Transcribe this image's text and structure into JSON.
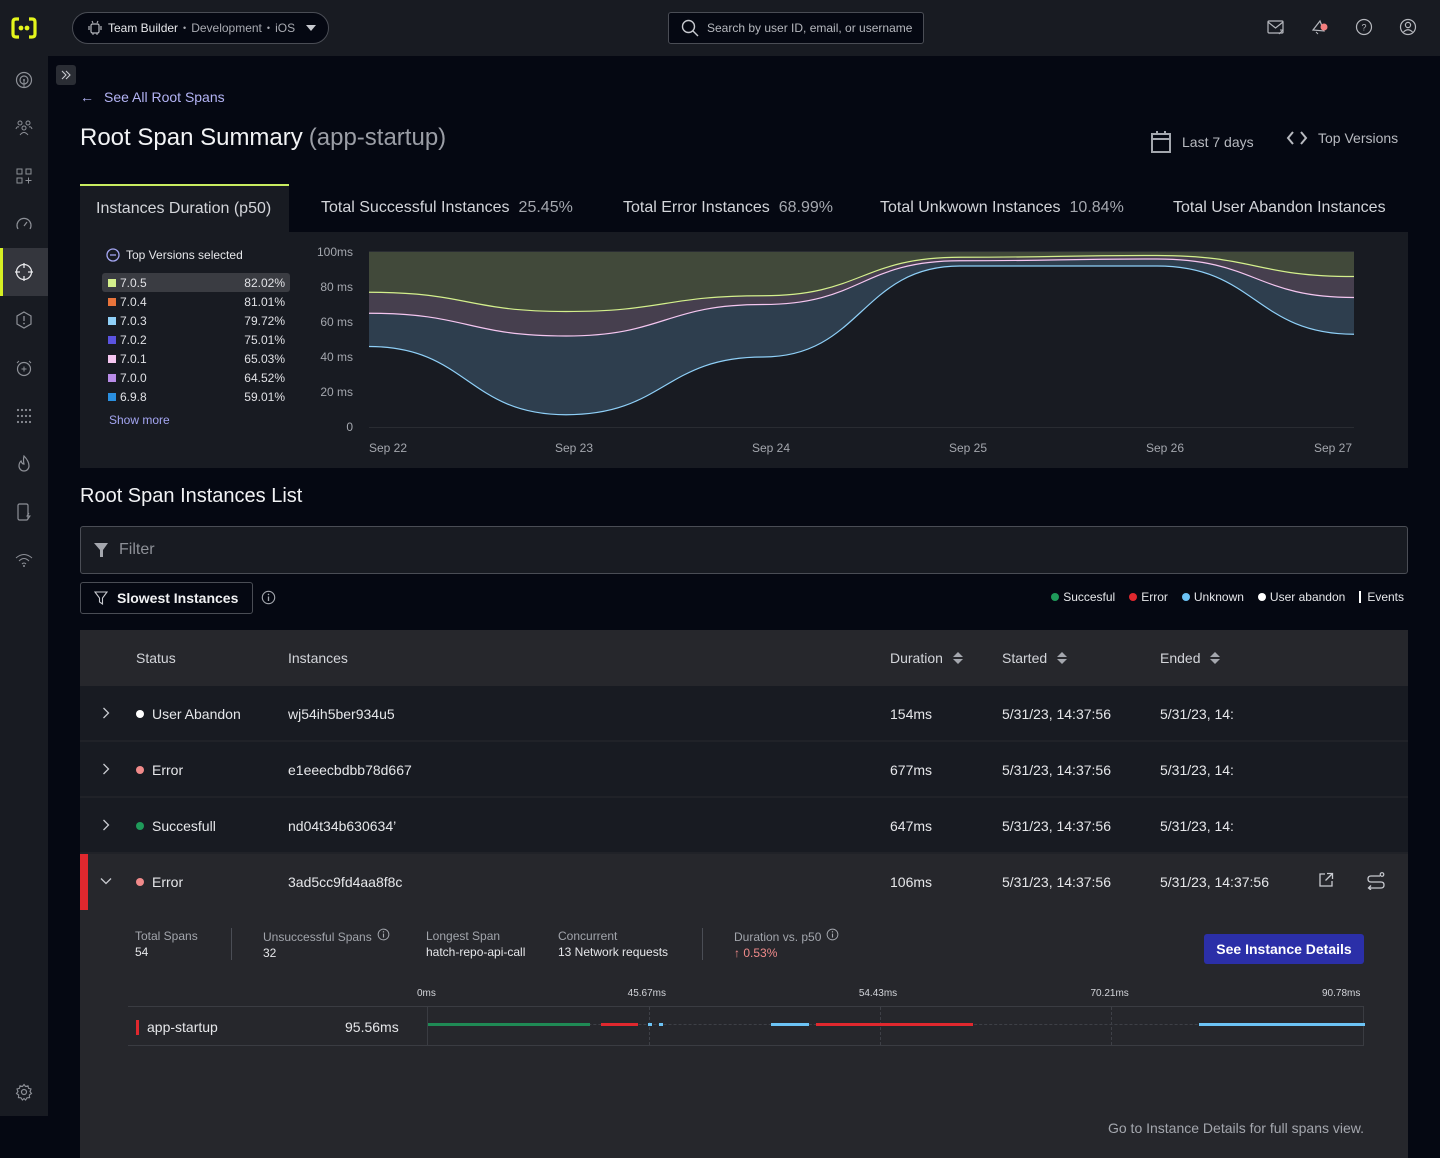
{
  "topbar": {
    "app_name": "Team Builder",
    "environment": "Development",
    "platform": "iOS",
    "search_placeholder": "Search by user ID, email, or username",
    "icons": [
      "mail-share-icon",
      "notification-bell-icon",
      "help-icon",
      "account-icon"
    ]
  },
  "sidebar": {
    "items": [
      {
        "icon": "radar-icon",
        "active": false
      },
      {
        "icon": "users-icon",
        "active": false
      },
      {
        "icon": "dashboard-add-icon",
        "active": false
      },
      {
        "icon": "performance-gauge-icon",
        "active": false
      },
      {
        "icon": "crosshair-target-icon",
        "active": true
      },
      {
        "icon": "alert-hexagon-icon",
        "active": false
      },
      {
        "icon": "alarm-icon",
        "active": false
      },
      {
        "icon": "grid-dots-icon",
        "active": false
      },
      {
        "icon": "flame-icon",
        "active": false
      },
      {
        "icon": "device-power-icon",
        "active": false
      },
      {
        "icon": "wifi-icon",
        "active": false
      }
    ],
    "settings_icon": "gear-icon"
  },
  "header": {
    "back_label": "See All Root Spans",
    "title": "Root Span Summary",
    "subtitle": "(app-startup)",
    "date_range": "Last 7 days",
    "versions_label": "Top Versions"
  },
  "tabs": [
    {
      "label": "Instances Duration (p50)",
      "value": "",
      "active": true
    },
    {
      "label": "Total Successful Instances",
      "value": "25.45%",
      "active": false
    },
    {
      "label": "Total Error Instances",
      "value": "68.99%",
      "active": false
    },
    {
      "label": "Total Unkwown Instances",
      "value": "10.84%",
      "active": false
    },
    {
      "label": "Total User Abandon Instances",
      "value": "",
      "active": false
    }
  ],
  "versions_legend": {
    "title": "Top Versions selected",
    "items": [
      {
        "version": "7.0.5",
        "pct": "82.02%",
        "color": "#d4f08c",
        "selected": true
      },
      {
        "version": "7.0.4",
        "pct": "81.01%",
        "color": "#e8743b",
        "selected": false
      },
      {
        "version": "7.0.3",
        "pct": "79.72%",
        "color": "#8fd0f8",
        "selected": false
      },
      {
        "version": "7.0.2",
        "pct": "75.01%",
        "color": "#5b53e0",
        "selected": false
      },
      {
        "version": "7.0.1",
        "pct": "65.03%",
        "color": "#f5c6f0",
        "selected": false
      },
      {
        "version": "7.0.0",
        "pct": "64.52%",
        "color": "#b98ce8",
        "selected": false
      },
      {
        "version": "6.9.8",
        "pct": "59.01%",
        "color": "#2a8fe0",
        "selected": false
      }
    ],
    "show_more": "Show more"
  },
  "chart_data": {
    "type": "area",
    "title": "Instances Duration (p50)",
    "xlabel": "",
    "ylabel": "",
    "x": [
      "Sep 22",
      "Sep 23",
      "Sep 24",
      "Sep 25",
      "Sep 26",
      "Sep 27"
    ],
    "y_ticks": [
      "0",
      "20 ms",
      "40 ms",
      "60 ms",
      "80 ms",
      "100ms"
    ],
    "ylim": [
      0,
      100
    ],
    "grid": false,
    "series": [
      {
        "name": "7.0.5",
        "color": "#d4f08c",
        "fill": "#41493a",
        "values": [
          77,
          66,
          75,
          97,
          98,
          86
        ]
      },
      {
        "name": "7.0.1",
        "color": "#f5c6f0",
        "fill": "#463f4e",
        "values": [
          65,
          52,
          70,
          95,
          96,
          74
        ]
      },
      {
        "name": "7.0.3",
        "color": "#8fd0f8",
        "fill": "#2e3e4e",
        "values": [
          46,
          7,
          40,
          92,
          92,
          53
        ]
      }
    ]
  },
  "list": {
    "title": "Root Span Instances List",
    "filter_placeholder": "Filter",
    "slowest_label": "Slowest Instances",
    "status_legend": [
      {
        "label": "Succesful",
        "color": "#1f9a5a"
      },
      {
        "label": "Error",
        "color": "#e0282e"
      },
      {
        "label": "Unknown",
        "color": "#6cc3f5"
      },
      {
        "label": "User abandon",
        "color": "#ffffff"
      }
    ],
    "events_label": "Events",
    "columns": [
      "Status",
      "Instances",
      "Duration",
      "Started",
      "Ended"
    ],
    "rows": [
      {
        "status": "User Abandon",
        "dot": "#ffffff",
        "instance": "wj54ih5ber934u5",
        "duration": "154ms",
        "started": "5/31/23, 14:37:56",
        "ended": "5/31/23, 14:"
      },
      {
        "status": "Error",
        "dot": "#f08a8a",
        "instance": "e1eeecbdbb78d667",
        "duration": "677ms",
        "started": "5/31/23, 14:37:56",
        "ended": "5/31/23, 14:"
      },
      {
        "status": "Succesfull",
        "dot": "#1f9a5a",
        "instance": "nd04t34b630634’",
        "duration": "647ms",
        "started": "5/31/23, 14:37:56",
        "ended": "5/31/23, 14:"
      },
      {
        "status": "Error",
        "dot": "#f08a8a",
        "instance": "3ad5cc9fd4aa8f8c",
        "duration": "106ms",
        "started": "5/31/23, 14:37:56",
        "ended": "5/31/23, 14:37:56",
        "expanded": true
      }
    ]
  },
  "detail": {
    "metrics": [
      {
        "label": "Total Spans",
        "value": "54"
      },
      {
        "label": "Unsuccessful Spans",
        "value": "32"
      },
      {
        "label": "Longest Span",
        "value": "hatch-repo-api-call"
      },
      {
        "label": "Concurrent",
        "value": "13 Network requests"
      },
      {
        "label": "Duration vs. p50",
        "value": "↑ 0.53%"
      }
    ],
    "see_details_label": "See Instance Details",
    "timeline": {
      "ticks": [
        "0ms",
        "45.67ms",
        "54.43ms",
        "70.21ms",
        "90.78ms"
      ],
      "span_name": "app-startup",
      "span_duration": "95.56ms",
      "segments": [
        {
          "status": "success",
          "start_ms": 0,
          "end_ms": 16.5,
          "color": "#1f8a55"
        },
        {
          "status": "error",
          "start_ms": 17.6,
          "end_ms": 21.4,
          "color": "#e0282e"
        },
        {
          "status": "unknown",
          "start_ms": 22.4,
          "end_ms": 22.8,
          "color": "#6cc3f5"
        },
        {
          "status": "unknown",
          "start_ms": 23.6,
          "end_ms": 24.0,
          "color": "#6cc3f5"
        },
        {
          "status": "unknown",
          "start_ms": 35.0,
          "end_ms": 38.9,
          "color": "#6cc3f5"
        },
        {
          "status": "error",
          "start_ms": 39.6,
          "end_ms": 55.6,
          "color": "#e0282e"
        },
        {
          "status": "unknown",
          "start_ms": 78.6,
          "end_ms": 95.56,
          "color": "#6cc3f5"
        }
      ]
    },
    "footnote": "Go to Instance Details for full spans view."
  }
}
